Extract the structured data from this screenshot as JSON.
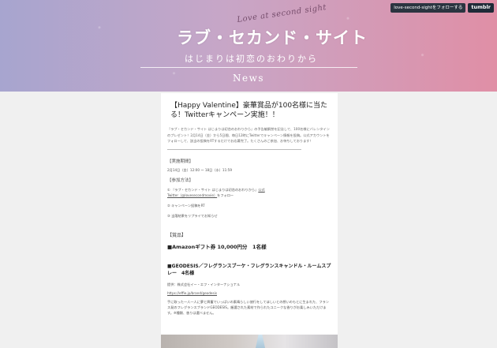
{
  "tumblr": {
    "follow_label": "love-second-sightをフォローする",
    "logo_label": "tumblr"
  },
  "header": {
    "script_logo": "Love at second sight",
    "title": "ラブ・セカンド・サイト",
    "subtitle": "はじまりは初恋のおわりから",
    "section": "News"
  },
  "post": {
    "title": "【Happy Valentine】豪華賞品が100名様に当たる！Twitterキャンペーン実施！！",
    "intro": "『ラブ・セカンド・サイト はじまりは初恋のおわりから』の予告編解禁を記念して、100名様にバレンタインのプレゼント！2月14日（金）から5日間、毎日12時にTwitterでキャンペーン情報を投稿。公式アカウントをフォローして、該当の投稿をRTするだけでお応募完了。たくさんのご参加、お待ちしております！",
    "period_heading": "【実施期間】",
    "period_text": "2月14日（金）12:00 〜 18日（水）11:59",
    "how_heading": "【参加方法】",
    "step1_prefix": "① 『ラブ・セカンド・サイト はじまりは初恋のおわりから』",
    "step1_link_a": "公式",
    "step1_link_b": "Twitter（@lovesecondmovie）",
    "step1_suffix": "をフォロー",
    "step2": "② キャンペーン投稿をRT",
    "step3": "③ 当落結果をリプライでお知らせ",
    "prize_heading": "【賞品】",
    "prize_main": "■Amazonギフト券 10,000円分　1名様",
    "product_title": "■GEODESIS／フレグランスブーケ・フレグランスキャンドル・ルームスプレー　4名様",
    "provider": "提供：株式会社イー・エフ・インターナショナル",
    "provider_link": "https://effie.jp/brand/geodesis",
    "description": "手に取った一人一人に夢と興奮でいっぱいの素晴らしい旅行をしてほしいとの想いのもとに生まれた、フランス発のフレグランスブランドGEODESIS。厳選された素材で作られたユニークな香りがお楽しみいただけます。※種類、香りは選べません。"
  }
}
